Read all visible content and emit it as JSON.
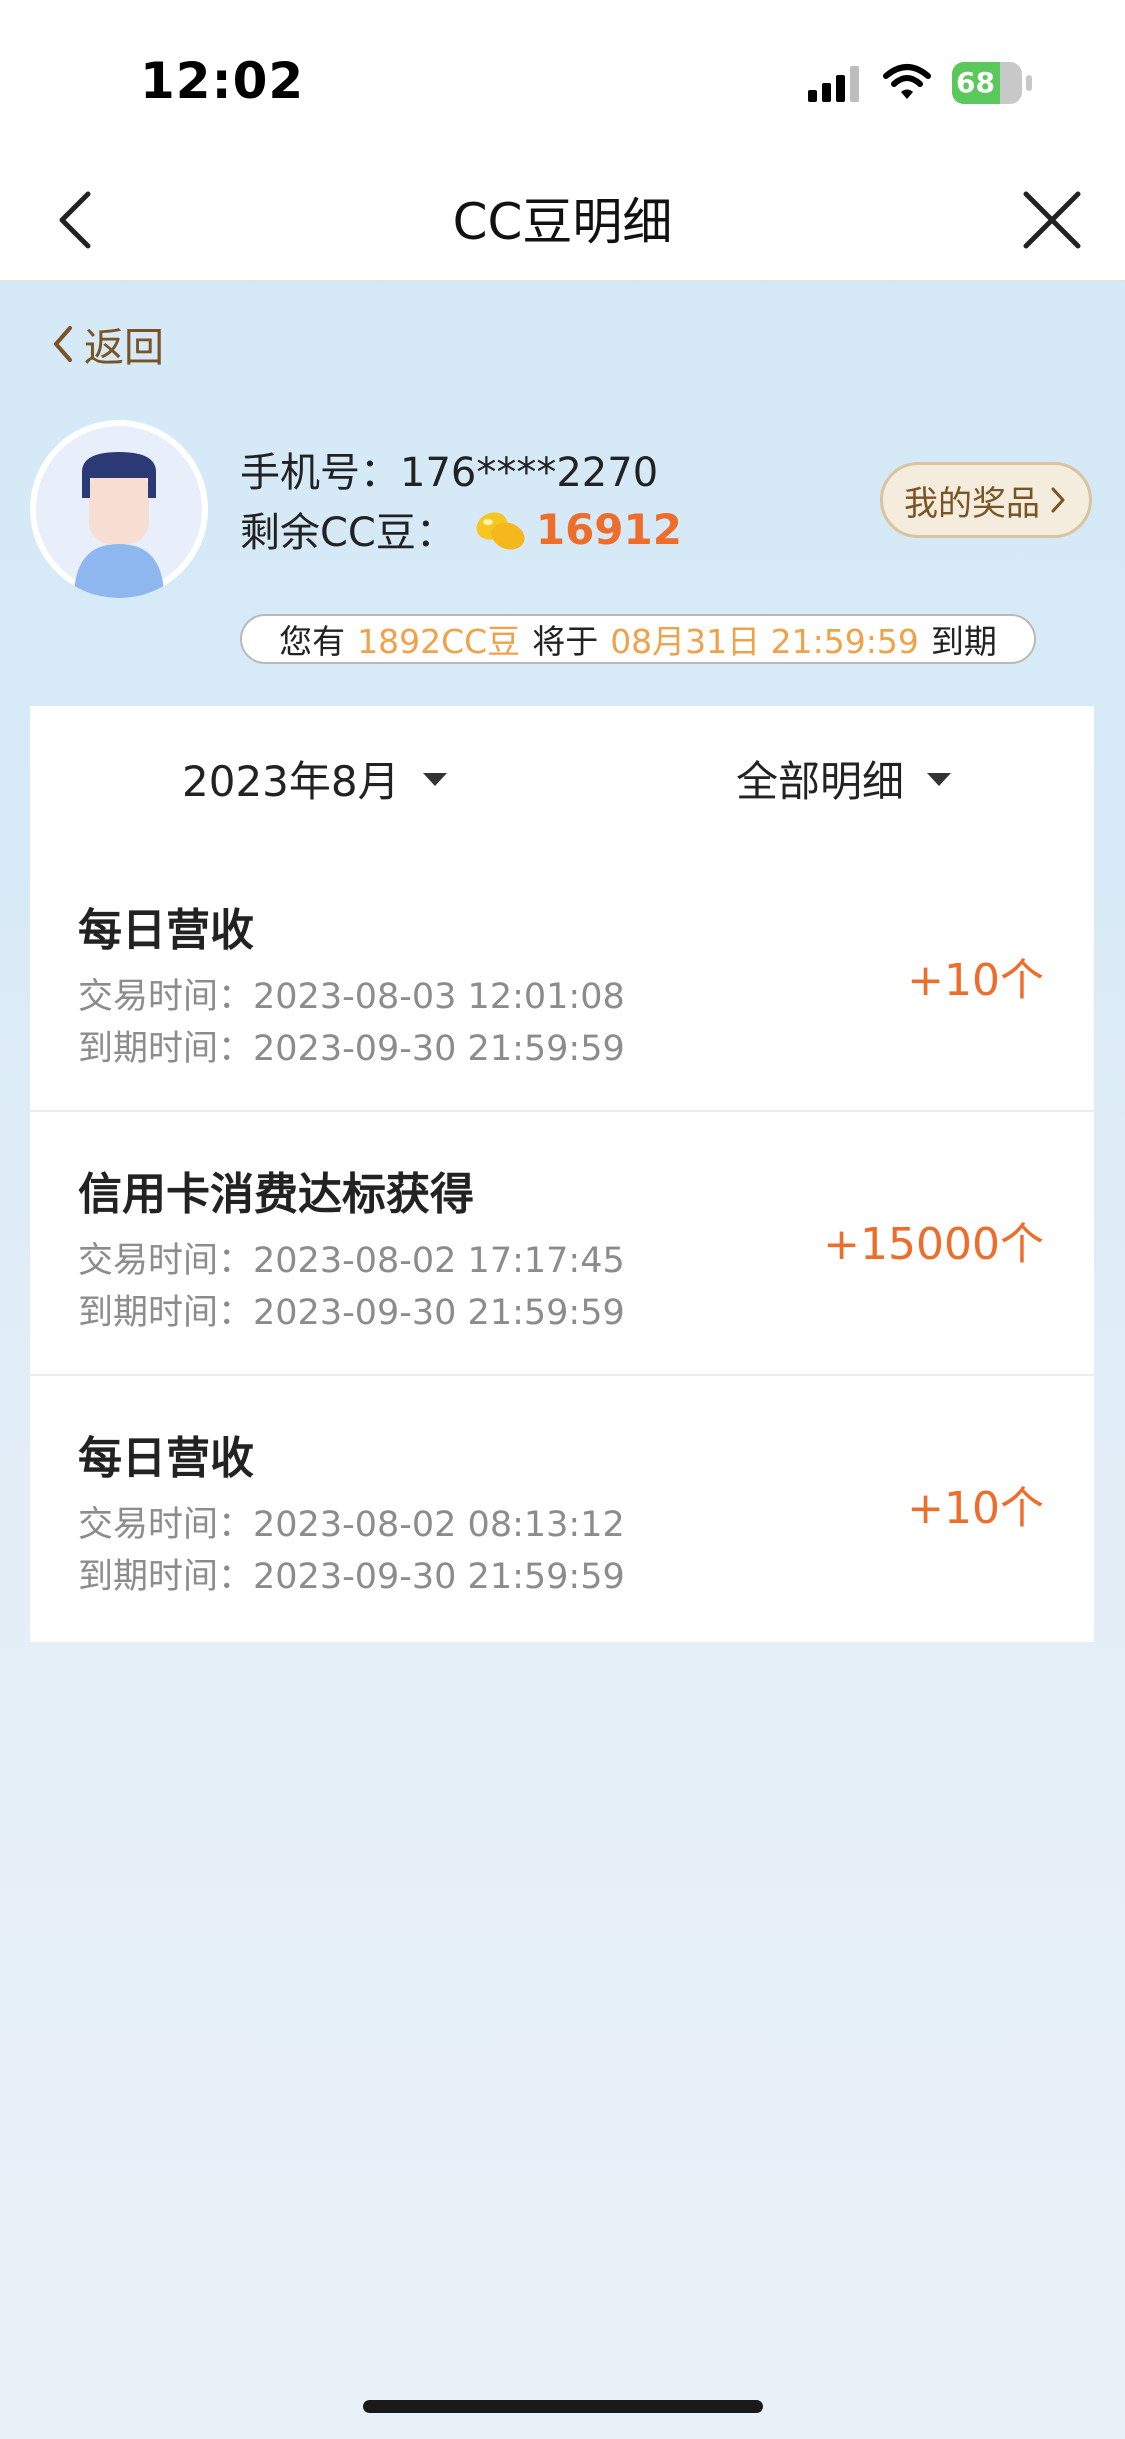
{
  "status_bar": {
    "time": "12:02",
    "battery_label": "68",
    "battery_level": 0.68,
    "battery_color": "#5ac85a"
  },
  "nav": {
    "title": "CC豆明细",
    "back_icon": "chevron-left-icon",
    "close_icon": "close-icon"
  },
  "back_link": {
    "label": "返回"
  },
  "profile": {
    "phone_label": "手机号：",
    "phone": "176****2270",
    "beans_label": "剩余CC豆：",
    "bean_icon": "bean-icon",
    "beans": "16912",
    "prizes_button": "我的奖品"
  },
  "expiry": {
    "prefix": "您有",
    "amount": "1892CC豆",
    "middle": "将于",
    "date": "08月31日 21:59:59",
    "suffix": "到期"
  },
  "filters": {
    "month": "2023年8月",
    "type": "全部明细"
  },
  "records": [
    {
      "title": "每日营收",
      "trade_label": "交易时间：",
      "trade_time": "2023-08-03 12:01:08",
      "expire_label": "到期时间：",
      "expire_time": "2023-09-30 21:59:59",
      "amount": "+10个"
    },
    {
      "title": "信用卡消费达标获得",
      "trade_label": "交易时间：",
      "trade_time": "2023-08-02 17:17:45",
      "expire_label": "到期时间：",
      "expire_time": "2023-09-30 21:59:59",
      "amount": "+15000个"
    },
    {
      "title": "每日营收",
      "trade_label": "交易时间：",
      "trade_time": "2023-08-02 08:13:12",
      "expire_label": "到期时间：",
      "expire_time": "2023-09-30 21:59:59",
      "amount": "+10个"
    }
  ],
  "colors": {
    "accent": "#ee6d2b",
    "highlight": "#f0a24a",
    "brown": "#7a5424",
    "background": "#d3e8f7"
  }
}
